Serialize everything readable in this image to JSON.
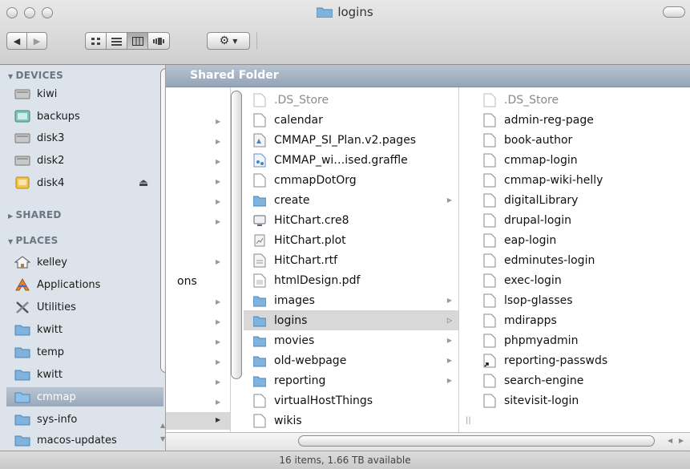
{
  "window": {
    "title": "logins",
    "status": "16 items, 1.66 TB available"
  },
  "sidebar": {
    "devices_header": "DEVICES",
    "devices": [
      {
        "label": "kiwi",
        "icon": "hard-drive-icon"
      },
      {
        "label": "backups",
        "icon": "external-drive-icon"
      },
      {
        "label": "disk3",
        "icon": "hard-drive-icon"
      },
      {
        "label": "disk2",
        "icon": "hard-drive-icon"
      },
      {
        "label": "disk4",
        "icon": "external-drive-icon"
      }
    ],
    "shared_header": "SHARED",
    "places_header": "PLACES",
    "places": [
      {
        "label": "kelley",
        "icon": "home-icon"
      },
      {
        "label": "Applications",
        "icon": "applications-icon"
      },
      {
        "label": "Utilities",
        "icon": "utilities-icon"
      },
      {
        "label": "kwitt",
        "icon": "folder-icon"
      },
      {
        "label": "temp",
        "icon": "folder-icon"
      },
      {
        "label": "kwitt",
        "icon": "folder-icon"
      },
      {
        "label": "cmmap",
        "icon": "folder-icon"
      },
      {
        "label": "sys-info",
        "icon": "folder-icon"
      },
      {
        "label": "macos-updates",
        "icon": "folder-icon"
      }
    ]
  },
  "path_bar": {
    "label": "Shared Folder"
  },
  "column1": {
    "partial_text": "ons"
  },
  "column2": [
    {
      "name": ".DS_Store",
      "type": "file",
      "dim": true
    },
    {
      "name": "calendar",
      "type": "file"
    },
    {
      "name": "CMMAP_SI_Plan.v2.pages",
      "type": "pages"
    },
    {
      "name": "CMMAP_wi…ised.graffle",
      "type": "graffle"
    },
    {
      "name": "cmmapDotOrg",
      "type": "file"
    },
    {
      "name": "create",
      "type": "folder"
    },
    {
      "name": "HitChart.cre8",
      "type": "file"
    },
    {
      "name": "HitChart.plot",
      "type": "file"
    },
    {
      "name": "HitChart.rtf",
      "type": "file"
    },
    {
      "name": "htmlDesign.pdf",
      "type": "pdf"
    },
    {
      "name": "images",
      "type": "folder"
    },
    {
      "name": "logins",
      "type": "folder",
      "selected": true
    },
    {
      "name": "movies",
      "type": "folder"
    },
    {
      "name": "old-webpage",
      "type": "folder"
    },
    {
      "name": "reporting",
      "type": "folder"
    },
    {
      "name": "virtualHostThings",
      "type": "file"
    },
    {
      "name": "wikis",
      "type": "file"
    }
  ],
  "column3": [
    {
      "name": ".DS_Store",
      "dim": true
    },
    {
      "name": "admin-reg-page"
    },
    {
      "name": "book-author"
    },
    {
      "name": "cmmap-login"
    },
    {
      "name": "cmmap-wiki-helly"
    },
    {
      "name": "digitalLibrary"
    },
    {
      "name": "drupal-login"
    },
    {
      "name": "eap-login"
    },
    {
      "name": "edminutes-login"
    },
    {
      "name": "exec-login"
    },
    {
      "name": "lsop-glasses"
    },
    {
      "name": "mdirapps"
    },
    {
      "name": "phpmyadmin"
    },
    {
      "name": "reporting-passwds",
      "alias": true
    },
    {
      "name": "search-engine"
    },
    {
      "name": "sitevisit-login"
    }
  ]
}
